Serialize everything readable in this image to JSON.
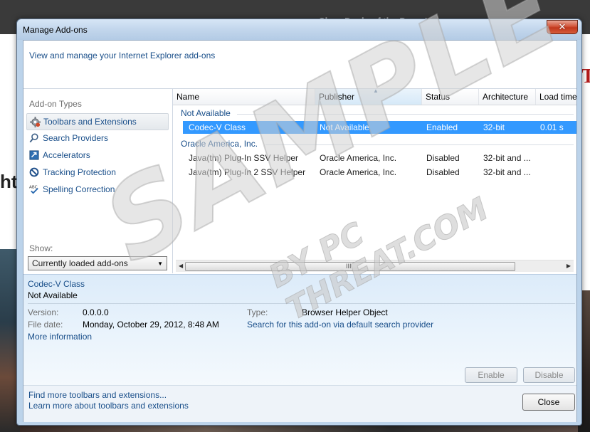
{
  "background": {
    "top_text": "Shop Deals of the Day · Learn more",
    "left_fragment": "ht",
    "right_fragment": "T"
  },
  "window": {
    "title": "Manage Add-ons",
    "close_symbol": "✕"
  },
  "header": {
    "link": "View and manage your Internet Explorer add-ons"
  },
  "addon_types": {
    "label": "Add-on Types",
    "items": [
      {
        "label": "Toolbars and Extensions",
        "icon": "gear-icon"
      },
      {
        "label": "Search Providers",
        "icon": "search-icon"
      },
      {
        "label": "Accelerators",
        "icon": "accelerator-icon"
      },
      {
        "label": "Tracking Protection",
        "icon": "block-icon"
      },
      {
        "label": "Spelling Correction",
        "icon": "spellcheck-icon"
      }
    ],
    "show_label": "Show:",
    "show_value": "Currently loaded add-ons"
  },
  "columns": [
    "Name",
    "Publisher",
    "Status",
    "Architecture",
    "Load time"
  ],
  "groups": [
    {
      "label": "Not Available",
      "rows": [
        {
          "name": "Codec-V Class",
          "publisher": "Not Available",
          "status": "Enabled",
          "architecture": "32-bit",
          "load_time": "0.01 s",
          "selected": true
        }
      ]
    },
    {
      "label": "Oracle America, Inc.",
      "rows": [
        {
          "name": "Java(tm) Plug-In SSV Helper",
          "publisher": "Oracle America, Inc.",
          "status": "Disabled",
          "architecture": "32-bit and ...",
          "load_time": "",
          "selected": false
        },
        {
          "name": "Java(tm) Plug-In 2 SSV Helper",
          "publisher": "Oracle America, Inc.",
          "status": "Disabled",
          "architecture": "32-bit and ...",
          "load_time": "",
          "selected": false
        }
      ]
    }
  ],
  "scrollbar": {
    "grip": "III",
    "left": "◀",
    "right": "▶"
  },
  "details": {
    "name": "Codec-V Class",
    "publisher": "Not Available",
    "version_label": "Version:",
    "version_value": "0.0.0.0",
    "file_date_label": "File date:",
    "file_date_value": "Monday, October 29, 2012, 8:48 AM",
    "more_info": "More information",
    "type_label": "Type:",
    "type_value": "Browser Helper Object",
    "search_link": "Search for this add-on via default search provider",
    "enable_label": "Enable",
    "disable_label": "Disable"
  },
  "footer": {
    "link1": "Find more toolbars and extensions...",
    "link2": "Learn more about toolbars and extensions",
    "close_label": "Close"
  },
  "watermark": {
    "main": "SAMPLE",
    "sub": "BY PC THREAT.COM"
  }
}
